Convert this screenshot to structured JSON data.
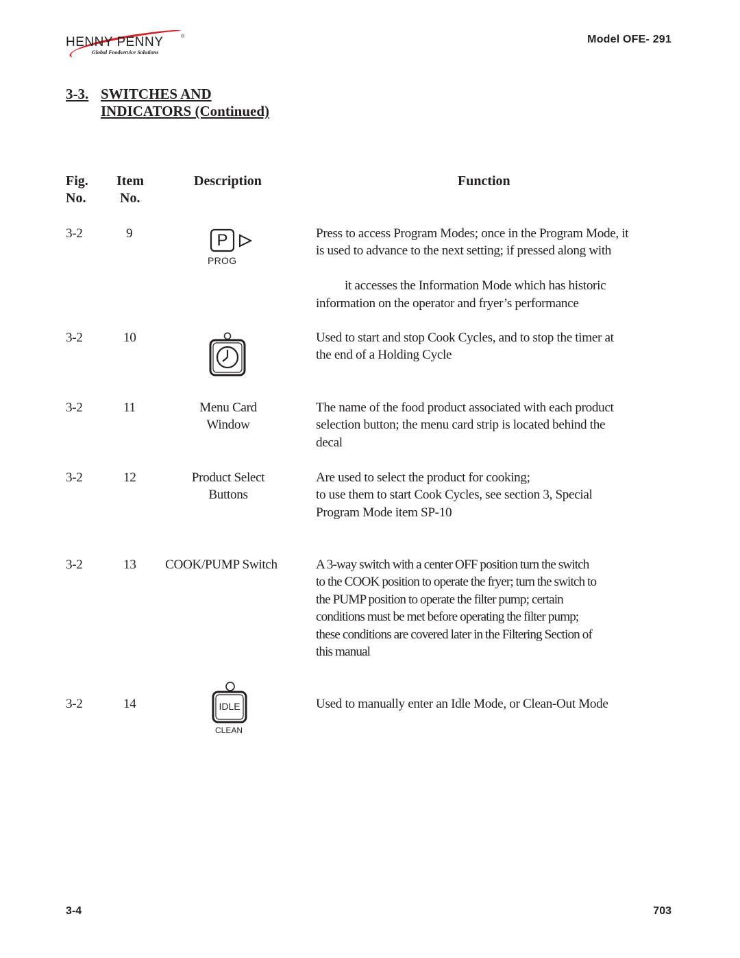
{
  "header": {
    "logo_text": "HENNY PENNY",
    "logo_tagline": "Global Foodservice Solutions",
    "logo_mark": "®",
    "model": "Model OFE- 291"
  },
  "section": {
    "number": "3-3.",
    "title_line1": "SWITCHES AND",
    "title_line2": "INDICATORS (Continued)"
  },
  "table": {
    "headers": {
      "fig_line1": "Fig.",
      "fig_line2": "No.",
      "item_line1": "Item",
      "item_line2": "No.",
      "description": "Description",
      "function": "Function"
    },
    "rows": [
      {
        "fig": "3-2",
        "item": "9",
        "description_icon": "prog-button-icon",
        "icon_label": "P",
        "icon_caption": "PROG",
        "function_lines": [
          "Press to access Program Modes; once in the Program Mode, it",
          "is used to advance to the next setting;  if pressed along with",
          "",
          "        it accesses the Information Mode which has historic",
          "information on the operator and fryer’s performance"
        ]
      },
      {
        "fig": "3-2",
        "item": "10",
        "description_icon": "timer-button-icon",
        "function_lines": [
          "Used to start and stop Cook Cycles, and to stop the timer at",
          "the end of a Holding Cycle"
        ]
      },
      {
        "fig": "3-2",
        "item": "11",
        "description_lines": [
          "Menu Card",
          "Window"
        ],
        "function_lines": [
          "The name of the food product associated with each product",
          "selection button;  the menu card strip is located behind the",
          "decal"
        ]
      },
      {
        "fig": "3-2",
        "item": "12",
        "description_lines": [
          "Product Select",
          "Buttons"
        ],
        "function_lines": [
          "Are used to select the product for cooking;",
          "to use them to start Cook Cycles, see section 3, Special",
          "Program Mode item SP-10"
        ]
      },
      {
        "fig": "3-2",
        "item": "13",
        "description_lines": [
          "COOK/PUMP Switch"
        ],
        "function_lines": [
          "A 3-way switch with a center OFF position turn the switch",
          "to the COOK position to operate the fryer;  turn the switch to",
          "the PUMP position to operate the filter pump;  certain",
          "conditions must be met before operating the filter pump;",
          "these conditions are covered later in the Filtering Section of",
          "this manual"
        ]
      },
      {
        "fig": "3-2",
        "item": "14",
        "description_icon": "idle-clean-button-icon",
        "icon_label": "IDLE",
        "icon_caption": "CLEAN",
        "function_lines": [
          "Used to manually enter an Idle Mode, or Clean-Out Mode"
        ]
      }
    ]
  },
  "footer": {
    "page": "3-4",
    "revision": "703"
  },
  "colors": {
    "text": "#231f20",
    "logo_swoosh": "#d2232a"
  }
}
